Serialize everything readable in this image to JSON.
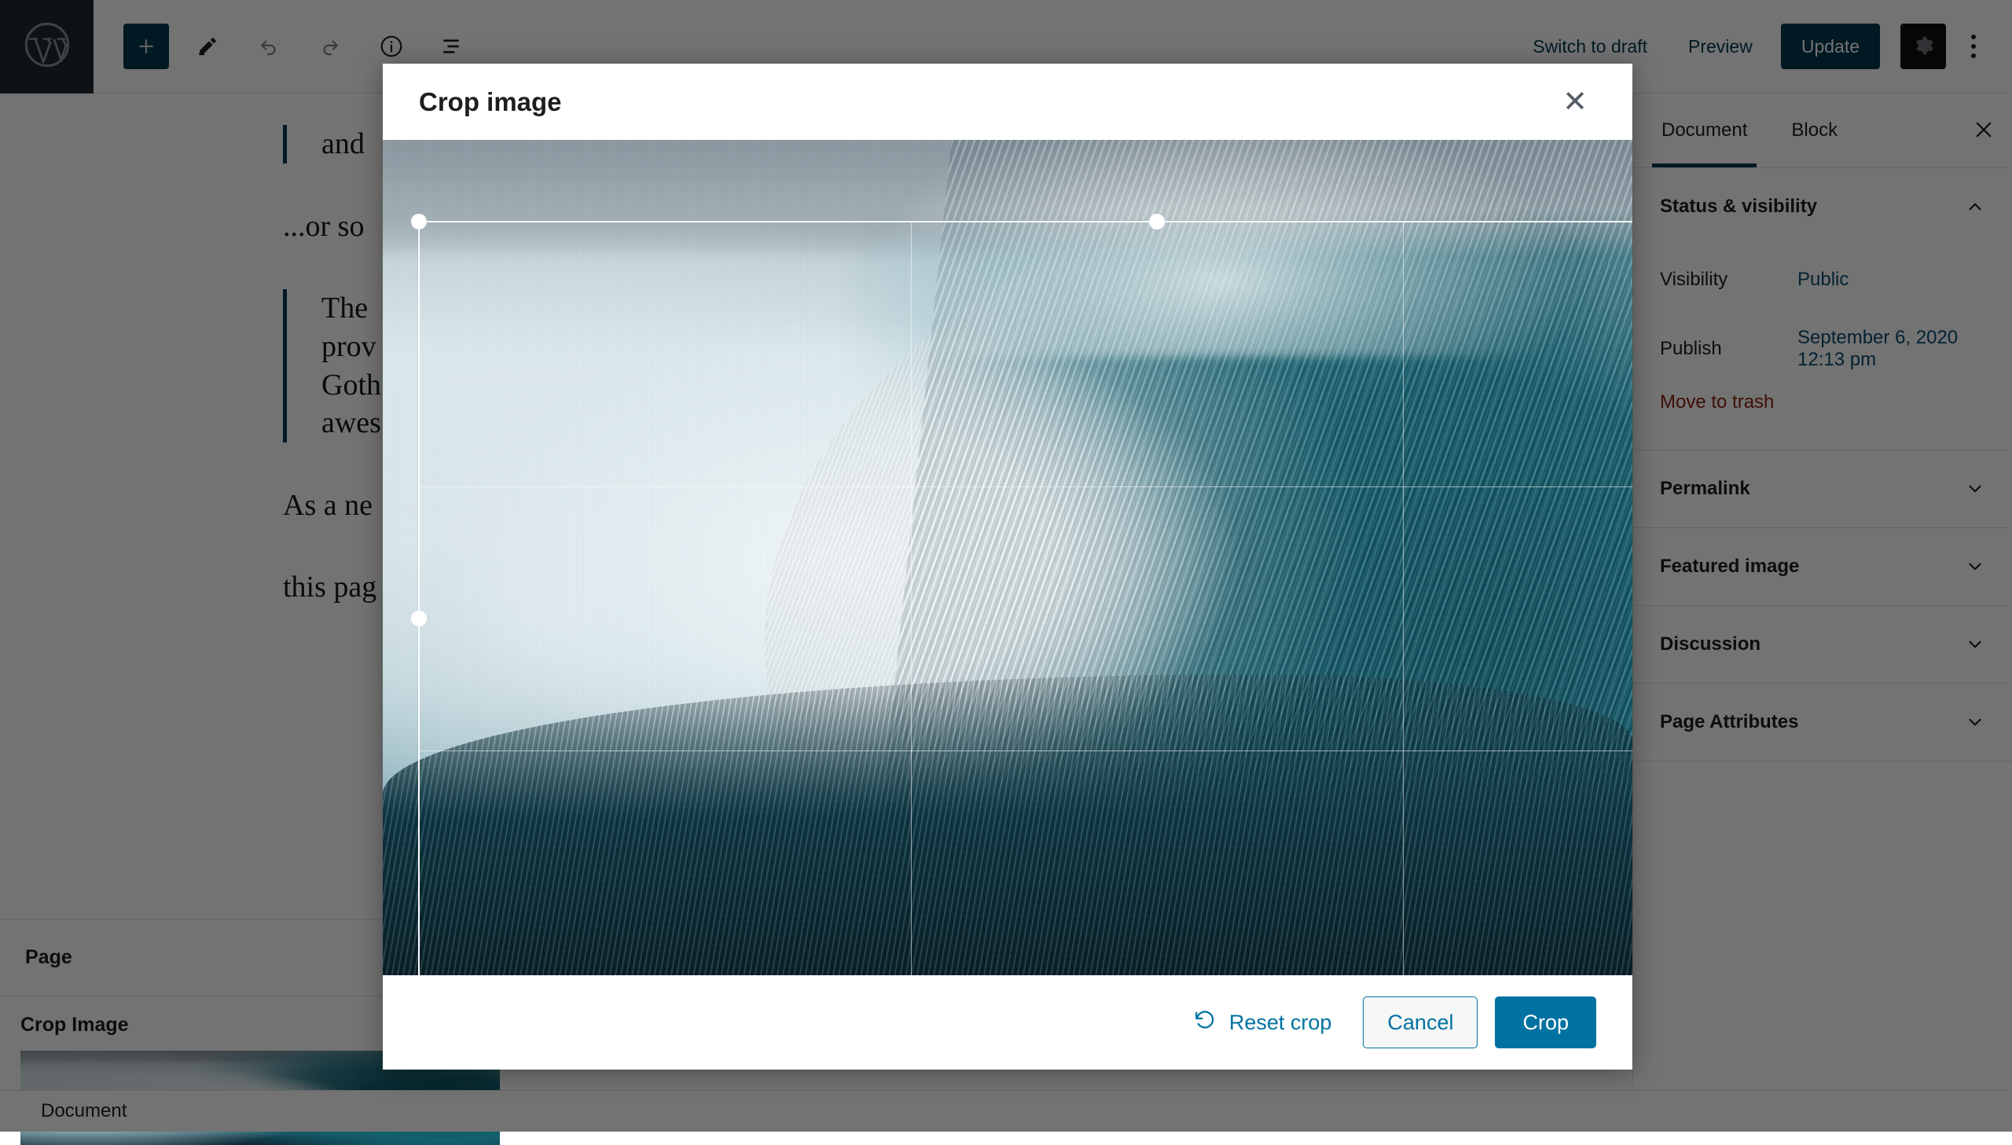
{
  "colors": {
    "brand_dark": "#00394f",
    "link_blue": "#0071a1",
    "sidebar_link": "#0b4a6f",
    "danger_red": "#8a1f11",
    "gear_active_bg": "#0e0e0e"
  },
  "topbar": {
    "logo_icon": "wordpress-logo-icon",
    "add_block_label": "+",
    "add_block_icon": "plus-icon",
    "edit_icon": "pencil-icon",
    "undo_icon": "undo-arrow-icon",
    "redo_icon": "redo-arrow-icon",
    "info_icon": "info-circle-icon",
    "list_view_icon": "list-view-icon",
    "switch_to_draft_label": "Switch to draft",
    "preview_label": "Preview",
    "update_label": "Update",
    "settings_icon": "gear-icon",
    "more_icon": "three-dots-vertical-icon"
  },
  "editor": {
    "blocks": [
      {
        "type": "quote",
        "text": "and"
      },
      {
        "type": "paragraph",
        "text": "...or so"
      },
      {
        "type": "quote",
        "lines": [
          "The",
          "prov",
          "Goth",
          "awes"
        ]
      },
      {
        "type": "paragraph",
        "lines": [
          "As a ne",
          "this pag"
        ]
      }
    ]
  },
  "bottom_panels": {
    "page_label": "Page",
    "crop_image_heading": "Crop Image",
    "thumbnail_icon": "wave-image-thumbnail",
    "breadcrumb_label": "Document"
  },
  "sidebar": {
    "tabs": [
      {
        "label": "Document",
        "active": true
      },
      {
        "label": "Block",
        "active": false
      }
    ],
    "close_icon": "close-icon",
    "panels": [
      {
        "title": "Status & visibility",
        "expanded": true,
        "chevron_icon": "chevron-up-icon",
        "rows": [
          {
            "key": "Visibility",
            "value": "Public"
          },
          {
            "key": "Publish",
            "value": "September 6, 2020 12:13 pm"
          }
        ],
        "trash_label": "Move to trash"
      },
      {
        "title": "Permalink",
        "expanded": false,
        "chevron_icon": "chevron-down-icon"
      },
      {
        "title": "Featured image",
        "expanded": false,
        "chevron_icon": "chevron-down-icon"
      },
      {
        "title": "Discussion",
        "expanded": false,
        "chevron_icon": "chevron-down-icon"
      },
      {
        "title": "Page Attributes",
        "expanded": false,
        "chevron_icon": "chevron-down-icon"
      }
    ]
  },
  "modal": {
    "title": "Crop image",
    "close_icon": "close-icon",
    "image_alt_name": "ocean-wave-photo",
    "crop_selection": {
      "handles": [
        "nw",
        "n",
        "ne",
        "w",
        "e",
        "sw",
        "s",
        "se"
      ],
      "grid": "rule-of-thirds"
    },
    "footer": {
      "reset_icon": "reset-undo-icon",
      "reset_label": "Reset crop",
      "cancel_label": "Cancel",
      "crop_label": "Crop"
    }
  }
}
